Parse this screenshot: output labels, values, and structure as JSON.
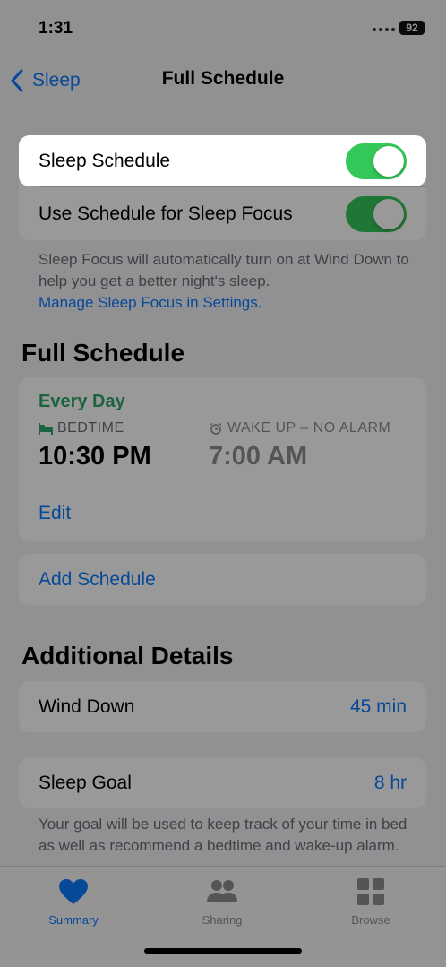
{
  "status_bar": {
    "time": "1:31",
    "battery": "92"
  },
  "nav": {
    "back_label": "Sleep",
    "title": "Full Schedule"
  },
  "focus_section": {
    "sleep_schedule_label": "Sleep Schedule",
    "sleep_schedule_on": true,
    "use_schedule_label": "Use Schedule for Sleep Focus",
    "use_schedule_on": true,
    "footnote": "Sleep Focus will automatically turn on at Wind Down to help you get a better night's sleep.",
    "manage_link": "Manage Sleep Focus in Settings."
  },
  "full_schedule": {
    "header": "Full Schedule",
    "days": "Every Day",
    "bedtime_label": "BEDTIME",
    "bedtime_value": "10:30 PM",
    "wake_label": "WAKE UP – NO ALARM",
    "wake_value": "7:00 AM",
    "edit_label": "Edit",
    "add_schedule_label": "Add Schedule"
  },
  "additional_details": {
    "header": "Additional Details",
    "wind_down_label": "Wind Down",
    "wind_down_value": "45 min",
    "sleep_goal_label": "Sleep Goal",
    "sleep_goal_value": "8 hr",
    "goal_footnote": "Your goal will be used to keep track of your time in bed as well as recommend a bedtime and wake-up alarm."
  },
  "tab_bar": {
    "items": [
      {
        "label": "Summary",
        "icon": "heart-icon",
        "active": true
      },
      {
        "label": "Sharing",
        "icon": "people-icon",
        "active": false
      },
      {
        "label": "Browse",
        "icon": "grid-icon",
        "active": false
      }
    ]
  },
  "colors": {
    "accent": "#0a7aff",
    "toggle_on": "#34c759",
    "sleep_green": "#2fa56b"
  }
}
